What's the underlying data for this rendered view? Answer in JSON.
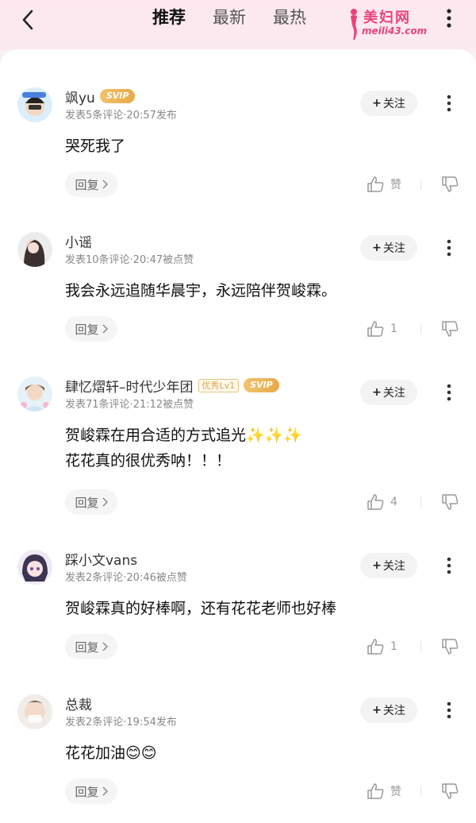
{
  "header": {
    "tabs": [
      {
        "label": "推荐",
        "active": true
      },
      {
        "label": "最新",
        "active": false
      },
      {
        "label": "最热",
        "active": false
      }
    ],
    "logo_title": "美妇网",
    "logo_url": "meili43.com"
  },
  "follow_label": "关注",
  "reply_label": "回复",
  "comments": [
    {
      "name": "飒yu",
      "badges": [
        "SVIP"
      ],
      "meta": "发表5条评论·20:57发布",
      "lines": [
        "哭死我了"
      ],
      "like_text": "赞"
    },
    {
      "name": "小谣",
      "badges": [],
      "meta": "发表10条评论·20:47被点赞",
      "lines": [
        "我会永远追随华晨宇，永远陪伴贺峻霖。"
      ],
      "like_text": "1"
    },
    {
      "name": "肆忆熠轩–时代少年团",
      "badges": [
        "优秀Lv1",
        "SVIP"
      ],
      "meta": "发表71条评论·21:12被点赞",
      "lines": [
        "贺峻霖在用合适的方式追光✨✨✨",
        "花花真的很优秀呐！！！"
      ],
      "like_text": "4"
    },
    {
      "name": "踩小文vans",
      "badges": [],
      "meta": "发表2条评论·20:46被点赞",
      "lines": [
        "贺峻霖真的好棒啊，还有花花老师也好棒"
      ],
      "like_text": "1"
    },
    {
      "name": "总裁",
      "badges": [],
      "meta": "发表2条评论·19:54发布",
      "lines": [
        "花花加油😊😊"
      ],
      "like_text": "赞"
    }
  ],
  "colors": {
    "header_bg": "#fde8ef",
    "logo": "#e8437c",
    "svip_badge": "#eab35a",
    "follow_bg": "#f3f3f3"
  }
}
